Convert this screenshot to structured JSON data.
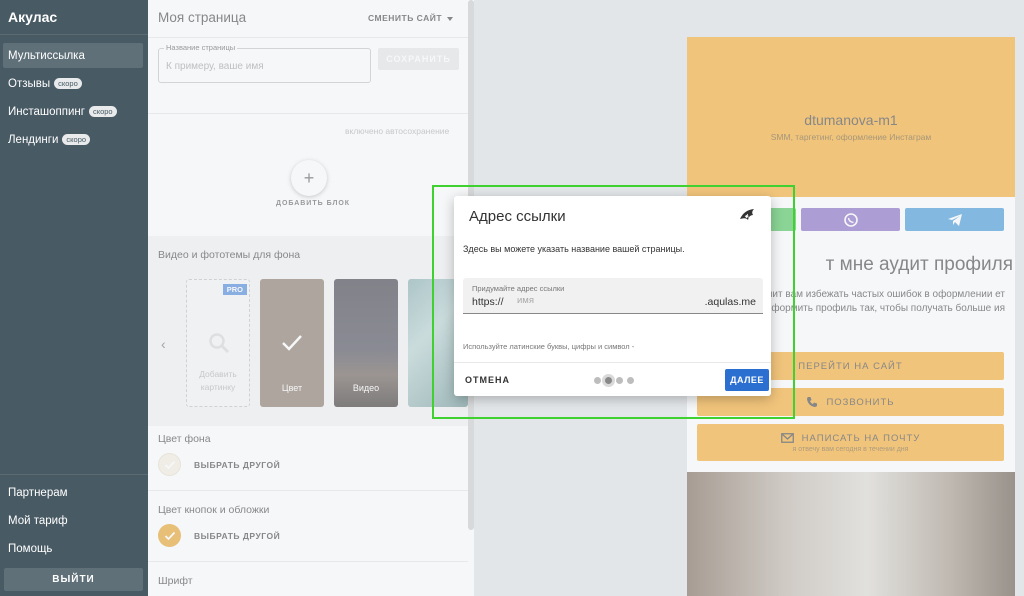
{
  "sidebar": {
    "brand": "Акулас",
    "items": [
      {
        "label": "Мультиссылка",
        "badge": ""
      },
      {
        "label": "Отзывы",
        "badge": "скоро"
      },
      {
        "label": "Инсташоппинг",
        "badge": "скоро"
      },
      {
        "label": "Лендинги",
        "badge": "скоро"
      }
    ],
    "bottom": [
      "Партнерам",
      "Мой тариф",
      "Помощь"
    ],
    "logout": "ВЫЙТИ"
  },
  "editor": {
    "title": "Моя страница",
    "switch_site": "СМЕНИТЬ САЙТ",
    "name_field_label": "Название страницы",
    "name_field_placeholder": "К примеру, ваше имя",
    "save": "СОХРАНИТЬ",
    "autosave": "включено автосохранение",
    "add_block": "ДОБАВИТЬ БЛОК",
    "bg_section_title": "Видео и фототемы для фона",
    "tile_add_pro": "PRO",
    "tile_add_text": "Добавить картинку",
    "tile_color": "Цвет",
    "tile_video": "Видео",
    "bg_color_title": "Цвет фона",
    "pick_other": "ВЫБРАТЬ ДРУГОЙ",
    "buttons_color_title": "Цвет кнопок и обложки",
    "font_title": "Шрифт"
  },
  "preview": {
    "name": "dtumanova-m1",
    "subtitle": "SMM, таргетинг, оформление Инстаграм",
    "audit_title": "т мне аудит профиля",
    "audit_text": "позволит вам избежать частых ошибок в оформлении ет оформить профиль так, чтобы получать больше ия",
    "cta_site": "ПЕРЕЙТИ НА САЙТ",
    "cta_call": "ПОЗВОНИТЬ",
    "cta_mail": "НАПИСАТЬ НА ПОЧТУ",
    "cta_mail_sub": "я отвечу вам сегодня в течении дня"
  },
  "dialog": {
    "title": "Адрес ссылки",
    "description": "Здесь вы можете указать название вашей страницы.",
    "url_label": "Придумайте адрес ссылки",
    "url_prefix": "https://",
    "url_placeholder": "имя",
    "url_suffix": ".aqulas.me",
    "hint": "Используйте латинские буквы, цифры и символ -",
    "cancel": "ОТМЕНА",
    "next": "ДАЛЕЕ",
    "steps_total": 4,
    "step_current": 2
  },
  "colors": {
    "sidebar": "#485a64",
    "accent_orange": "#f6a21c",
    "primary_blue": "#2b6fd1",
    "highlight_green": "#3fd130"
  }
}
